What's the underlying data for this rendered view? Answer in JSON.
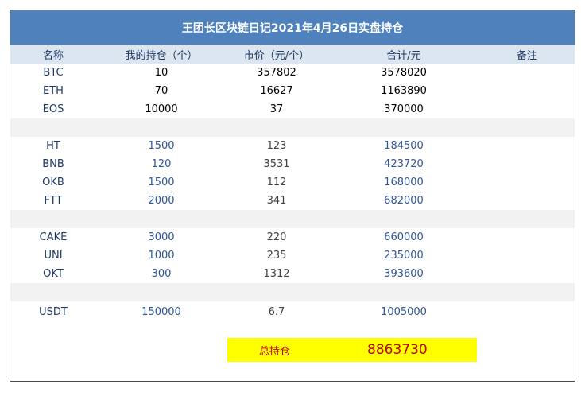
{
  "title": "王团长区块链日记2021年4月26日实盘持仓",
  "columns": {
    "name": "名称",
    "qty": "我的持仓（个）",
    "price": "市价（元/个）",
    "total": "合计/元",
    "note": "备注"
  },
  "rows": [
    {
      "name": "BTC",
      "qty": "10",
      "price": "357802",
      "total": "3578020"
    },
    {
      "name": "ETH",
      "qty": "70",
      "price": "16627",
      "total": "1163890"
    },
    {
      "name": "EOS",
      "qty": "10000",
      "price": "37",
      "total": "370000"
    },
    {
      "name": "HT",
      "qty": "1500",
      "price": "123",
      "total": "184500"
    },
    {
      "name": "BNB",
      "qty": "120",
      "price": "3531",
      "total": "423720"
    },
    {
      "name": "OKB",
      "qty": "1500",
      "price": "112",
      "total": "168000"
    },
    {
      "name": "FTT",
      "qty": "2000",
      "price": "341",
      "total": "682000"
    },
    {
      "name": "CAKE",
      "qty": "3000",
      "price": "220",
      "total": "660000"
    },
    {
      "name": "UNI",
      "qty": "1000",
      "price": "235",
      "total": "235000"
    },
    {
      "name": "OKT",
      "qty": "300",
      "price": "1312",
      "total": "393600"
    },
    {
      "name": "USDT",
      "qty": "150000",
      "price": "6.7",
      "total": "1005000"
    }
  ],
  "summary": {
    "label": "总持仓",
    "value": "8863730"
  },
  "colors": {
    "title_bg": "#4f81bd",
    "header_bg": "#dce6f1",
    "highlight": "#ffff00",
    "total_text": "#c00000"
  }
}
